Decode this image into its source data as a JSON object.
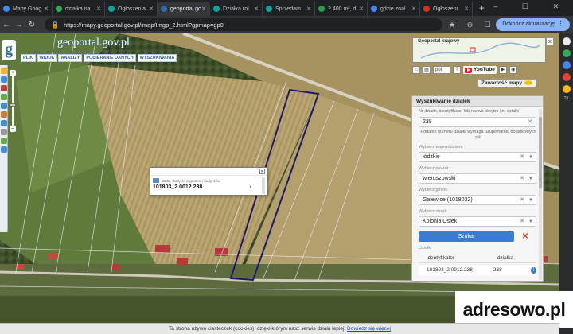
{
  "browser": {
    "tabs": [
      {
        "title": "Mapy Goog",
        "color": "#4285f4"
      },
      {
        "title": "działka na",
        "color": "#34a853"
      },
      {
        "title": "Ogłoszenia",
        "color": "#0aa5a0"
      },
      {
        "title": "geoportal.go",
        "color": "#2e6da4",
        "active": true
      },
      {
        "title": "Działka rol",
        "color": "#0aa5a0"
      },
      {
        "title": "Sprzedam",
        "color": "#0aa5a0"
      },
      {
        "title": "2 400 m², d",
        "color": "#2a9d4a"
      },
      {
        "title": "gdzie znal",
        "color": "#4285f4"
      },
      {
        "title": "Ogłoszeni",
        "color": "#d93025"
      }
    ],
    "new_tab_glyph": "+",
    "window_controls": "– ☐ ✕",
    "url": "https://mapy.geoportal.gov.pl/imap/Imgp_2.html?gpmap=gp0",
    "update_label": "Dokończ aktualizację"
  },
  "geoportal": {
    "logo_letter": "g",
    "logo_text": "geoportal.gov.pl",
    "menu": [
      "PLIK",
      "WIDOK",
      "ANALIZY",
      "POBIERANIE DANYCH",
      "WYSZUKIWANIA"
    ]
  },
  "overview": {
    "title": "Geoportal krajowy",
    "close": "x"
  },
  "controls": {
    "lang": "pol",
    "youtube": "YouTube",
    "content_label": "Zawartość mapy"
  },
  "search_panel": {
    "title": "Wyszukiwanie działek",
    "hint_top": "Nr działki, identyfikator lub nazwa obrębu i nr działki",
    "parcel_value": "238",
    "hint_mid": "Podanie numeru działki wymaga uzupełnienia dodatkowych pól",
    "voivodeship_label": "Wybierz województwo",
    "voivodeship_value": "łódzkie",
    "county_label": "Wybierz powiat",
    "county_value": "wieruszowski",
    "commune_label": "Wybierz gminę",
    "commune_value": "Galewice (1018032)",
    "precinct_label": "Wybierz obręb",
    "precinct_value": "Kolonia Osiek",
    "search_button": "Szukaj",
    "clear_button": "✕",
    "results_label": "Działki",
    "col_identifier": "identyfikator",
    "col_parcel": "działka",
    "result_identifier": "101803_2.0012.238",
    "result_parcel": "238"
  },
  "popup": {
    "label": "WMS, Budynki w gruncie i budynków",
    "value": "101803_2.0012.238"
  },
  "watermark": "adresowo.pl",
  "cookie": {
    "text": "Ta strona używa ciasteczek (cookies), dzięki którym nasz serwis działa lepiej.",
    "link": "Dowiedz się więcej"
  },
  "gutter": {
    "badge": "29"
  },
  "colors": {
    "accent": "#3a7bd5",
    "parcel_outline": "#1d1a6e",
    "cadastral_lines": "#e7e7f4"
  }
}
